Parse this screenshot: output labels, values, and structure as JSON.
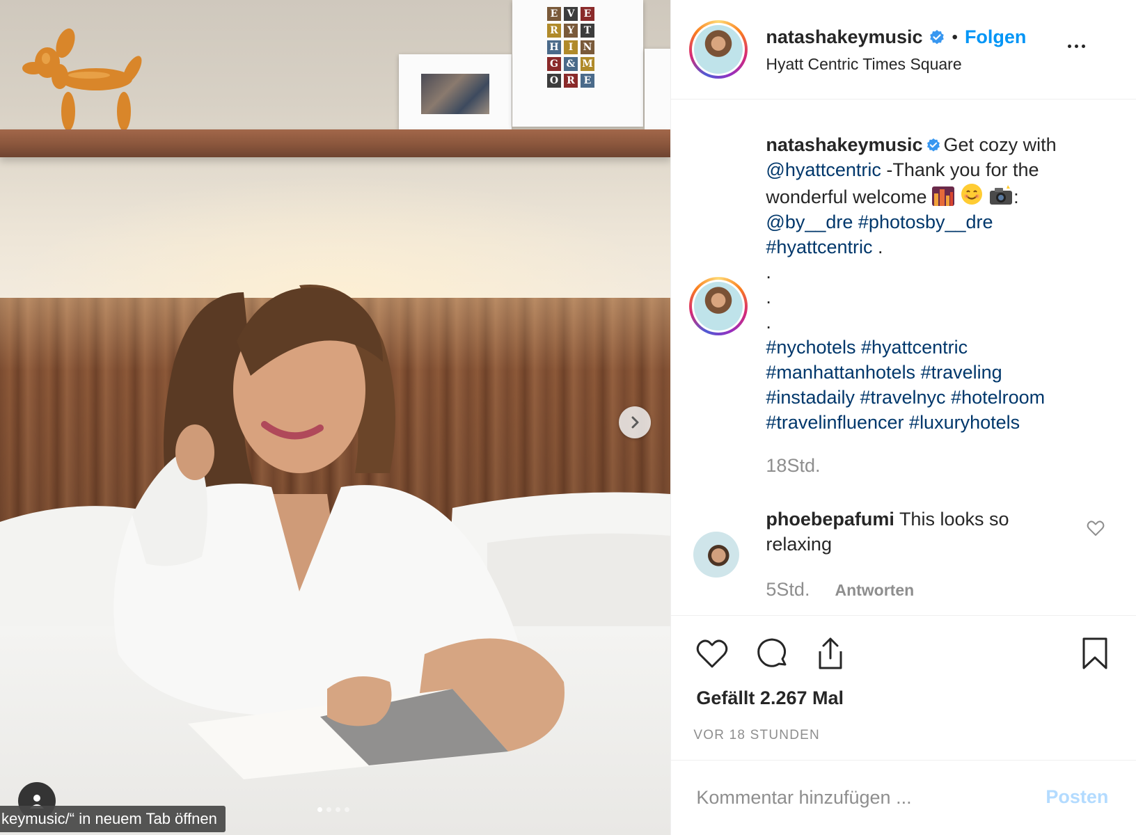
{
  "post": {
    "username": "natashakeymusic",
    "follow_label": "Folgen",
    "location": "Hyatt Centric Times Square"
  },
  "caption": {
    "line1_text": "Get cozy with",
    "mention1": "@hyattcentric",
    "line2_text": " -Thank you for the",
    "line3_text": "wonderful welcome",
    "line3_suffix": ":",
    "mention2": "@by__dre",
    "hashtag_photos": "#photosby__dre",
    "hashtag_hyatt": "#hyattcentric",
    "period": " .",
    "dots": [
      ".",
      ".",
      "."
    ],
    "hashtags": [
      [
        "#nychotels",
        "#hyattcentric"
      ],
      [
        "#manhattanhotels",
        "#traveling"
      ],
      [
        "#instadaily",
        "#travelnyc",
        "#hotelroom"
      ],
      [
        "#travelinfluencer",
        "#luxuryhotels"
      ]
    ],
    "time": "18Std."
  },
  "comment": {
    "username": "phoebepafumi",
    "text": "This looks so relaxing",
    "time": "5Std.",
    "reply_label": "Antworten"
  },
  "stats": {
    "likes_label": "Gefällt 2.267 Mal",
    "posted_label": "VOR 18 STUNDEN"
  },
  "comment_box": {
    "placeholder": "Kommentar hinzufügen ...",
    "post_label": "Posten"
  },
  "photo": {
    "tooltip": "keymusic/“ in neuem Tab öffnen",
    "carousel_dots": 4,
    "carousel_active": 1,
    "frame_letters": [
      "E",
      "V",
      "E",
      "",
      "R",
      "Y",
      "T",
      "",
      "H",
      "I",
      "N",
      "",
      "G",
      "&",
      "M",
      "",
      "O",
      "R",
      "E",
      ""
    ]
  },
  "icons": {
    "verified": "verified-badge-icon",
    "more": "more-options-icon",
    "next": "chevron-right-icon",
    "like": "heart-icon",
    "comment": "speech-bubble-icon",
    "share": "share-icon",
    "save": "bookmark-icon",
    "user_tag": "user-tag-icon"
  },
  "colors": {
    "accent": "#0095f6",
    "link": "#00376b",
    "muted": "#8e8e8e",
    "post_disabled": "#b3dbff"
  }
}
